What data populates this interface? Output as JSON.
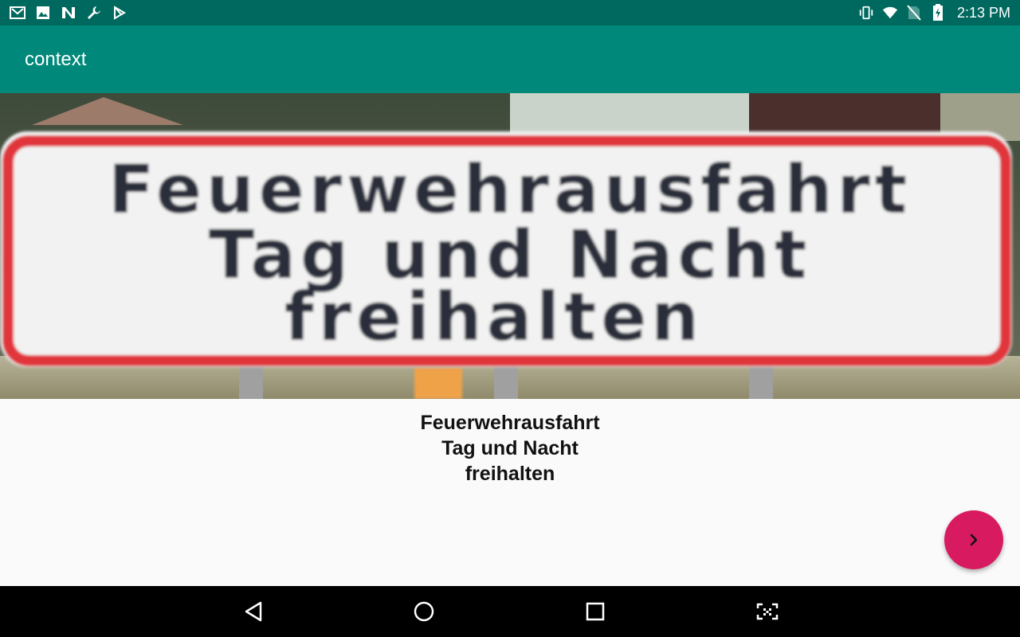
{
  "status_bar": {
    "time": "2:13 PM",
    "left_icons": [
      "gmail-icon",
      "image-icon",
      "n-app-icon",
      "wrench-icon",
      "play-store-icon"
    ],
    "right_icons": [
      "vibrate-icon",
      "wifi-icon",
      "no-sim-icon",
      "battery-charging-icon"
    ]
  },
  "app_bar": {
    "title": "context"
  },
  "photo": {
    "sign_line_1": "Feuerwehrausfahrt",
    "sign_line_2": "Tag und Nacht",
    "sign_line_3": "freihalten"
  },
  "caption": {
    "line_1": "Feuerwehrausfahrt",
    "line_2": "Tag und Nacht",
    "line_3": "freihalten"
  },
  "fab": {
    "icon": "chevron-right-icon"
  },
  "nav_bar": {
    "buttons": [
      "back-icon",
      "home-icon",
      "recents-icon",
      "screenshot-icon"
    ]
  },
  "colors": {
    "status_bar": "#00695f",
    "app_bar": "#00897b",
    "fab": "#d81b60",
    "sign_border": "#e0343a"
  }
}
